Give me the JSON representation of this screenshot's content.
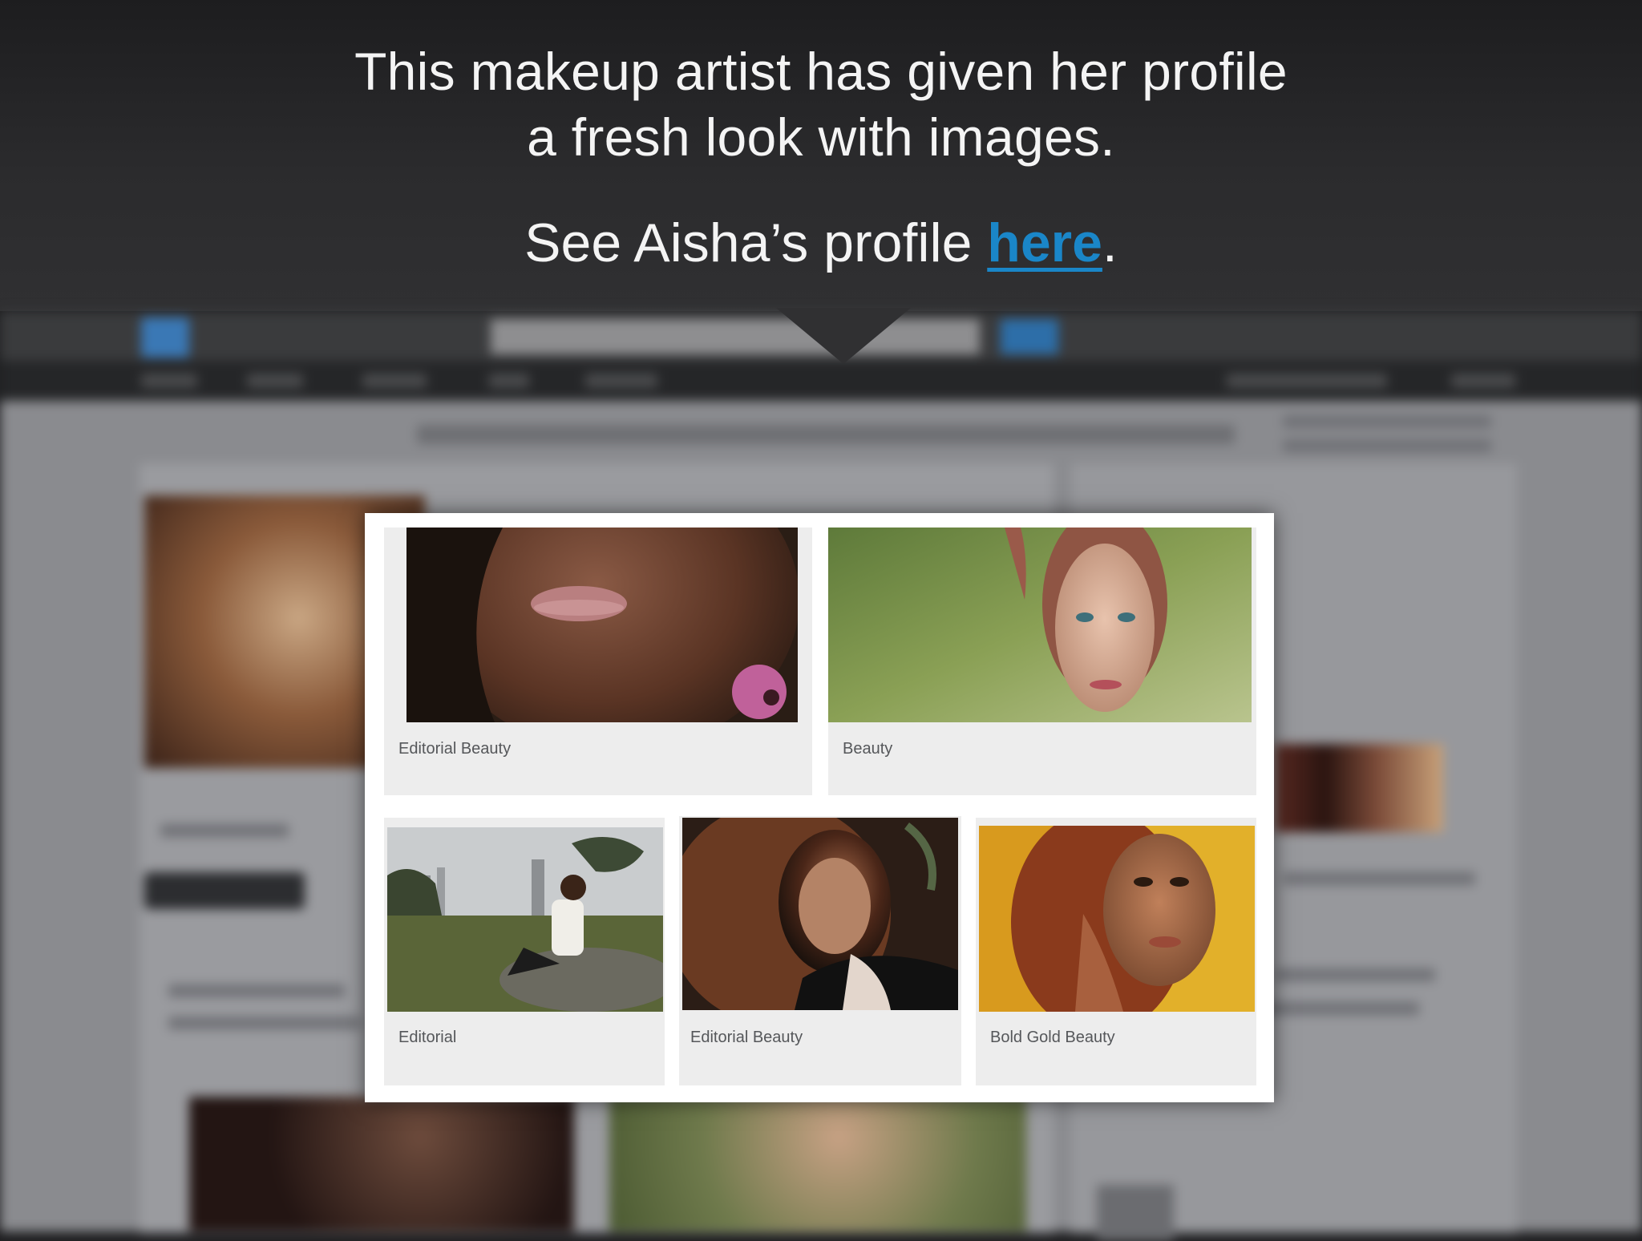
{
  "caption": {
    "line1": "This makeup artist has given her profile",
    "line2": "a fresh look with images."
  },
  "cta": {
    "prefix": "See Aisha’s profile ",
    "link_text": "here",
    "suffix": "."
  },
  "colors": {
    "link": "#1a86c8",
    "banner": "#2b2b2d",
    "tile_bg": "#ededed",
    "label": "#55575a"
  },
  "gallery": {
    "tiles": [
      {
        "label": "Editorial Beauty"
      },
      {
        "label": "Beauty"
      },
      {
        "label": "Editorial"
      },
      {
        "label": "Editorial Beauty"
      },
      {
        "label": "Bold Gold Beauty"
      }
    ]
  }
}
